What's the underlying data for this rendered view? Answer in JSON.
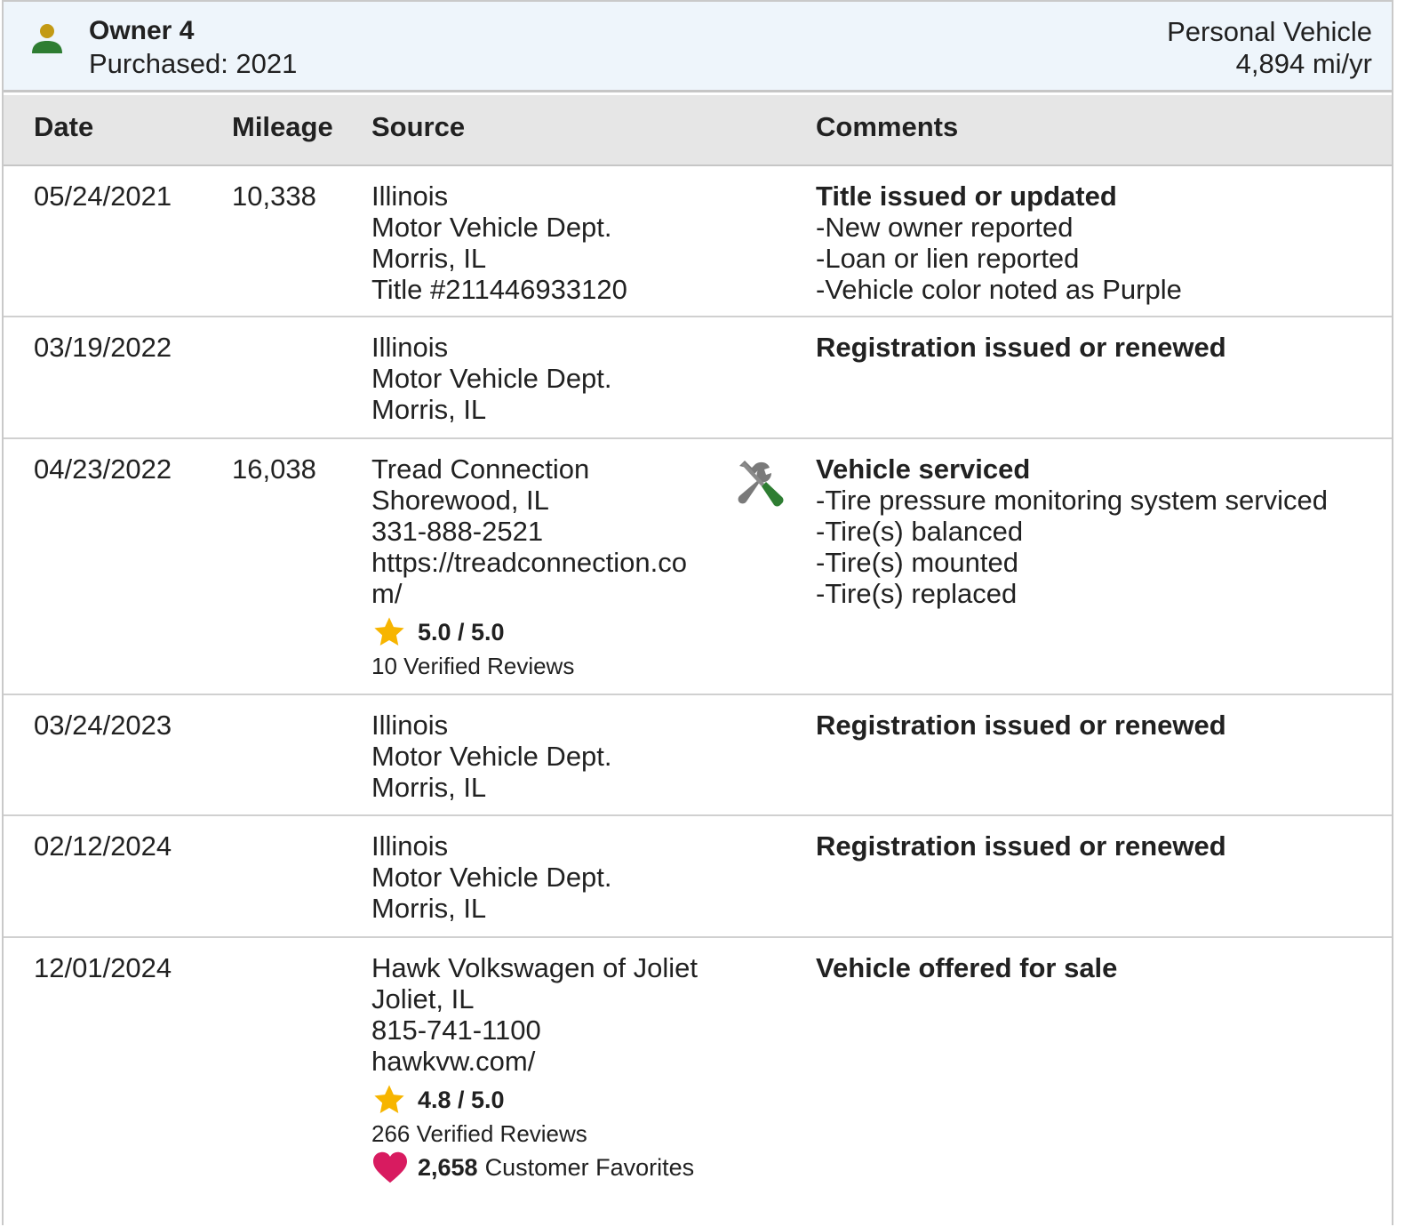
{
  "owner": {
    "title": "Owner 4",
    "purchased": "Purchased: 2021",
    "vehicle_type": "Personal Vehicle",
    "miles_per_year": "4,894 mi/yr",
    "icon": "person-icon"
  },
  "columns": {
    "date": "Date",
    "mileage": "Mileage",
    "source": "Source",
    "comments": "Comments"
  },
  "records": [
    {
      "date": "05/24/2021",
      "mileage": "10,338",
      "source": [
        "Illinois",
        "Motor Vehicle Dept.",
        "Morris, IL",
        "Title #211446933120"
      ],
      "comment_title": "Title issued or updated",
      "comment_items": [
        "New owner reported",
        "Loan or lien reported",
        "Vehicle color noted as Purple"
      ]
    },
    {
      "date": "03/19/2022",
      "mileage": "",
      "source": [
        "Illinois",
        "Motor Vehicle Dept.",
        "Morris, IL"
      ],
      "comment_title": "Registration issued or renewed",
      "comment_items": []
    },
    {
      "date": "04/23/2022",
      "mileage": "16,038",
      "source": [
        "Tread Connection",
        "Shorewood, IL",
        "331-888-2521"
      ],
      "source_url": "https://treadconnection.com/",
      "rating": "5.0 / 5.0",
      "reviews": "10 Verified Reviews",
      "icon": "service-wrench-screwdriver-icon",
      "comment_title": "Vehicle serviced",
      "comment_items": [
        "Tire pressure monitoring system serviced",
        "Tire(s) balanced",
        "Tire(s) mounted",
        "Tire(s) replaced"
      ]
    },
    {
      "date": "03/24/2023",
      "mileage": "",
      "source": [
        "Illinois",
        "Motor Vehicle Dept.",
        "Morris, IL"
      ],
      "comment_title": "Registration issued or renewed",
      "comment_items": []
    },
    {
      "date": "02/12/2024",
      "mileage": "",
      "source": [
        "Illinois",
        "Motor Vehicle Dept.",
        "Morris, IL"
      ],
      "comment_title": "Registration issued or renewed",
      "comment_items": []
    },
    {
      "date": "12/01/2024",
      "mileage": "",
      "source": [
        "Hawk Volkswagen of Joliet",
        "Joliet, IL",
        "815-741-1100",
        "hawkvw.com/"
      ],
      "rating": "4.8 / 5.0",
      "reviews": "266 Verified Reviews",
      "favorites_count": "2,658",
      "favorites_label": "Customer Favorites",
      "comment_title": "Vehicle offered for sale",
      "comment_items": []
    }
  ],
  "colors": {
    "header_bg": "#eef5fb",
    "table_header_bg": "#e6e6e6",
    "star": "#f7b500",
    "heart": "#d81b60",
    "person_head": "#c39a14",
    "person_body": "#2e7d32"
  }
}
